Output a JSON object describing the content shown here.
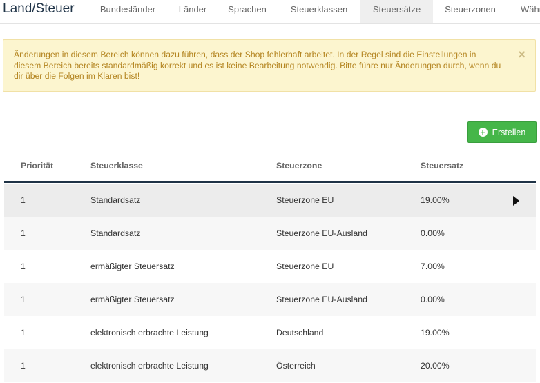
{
  "app_title": "Land/Steuer",
  "nav": {
    "tabs": [
      {
        "label": "Bundesländer",
        "active": false
      },
      {
        "label": "Länder",
        "active": false
      },
      {
        "label": "Sprachen",
        "active": false
      },
      {
        "label": "Steuerklassen",
        "active": false
      },
      {
        "label": "Steuersätze",
        "active": true
      },
      {
        "label": "Steuerzonen",
        "active": false
      },
      {
        "label": "Währ",
        "active": false
      }
    ]
  },
  "alert": {
    "text": "Änderungen in diesem Bereich können dazu führen, dass der Shop fehlerhaft arbeitet. In der Regel sind die Einstellungen in diesem Bereich bereits standardmäßig korrekt und es ist keine Bearbeitung notwendig. Bitte führe nur Änderungen durch, wenn du dir über die Folgen im Klaren bist!",
    "close_label": "×"
  },
  "toolbar": {
    "create_label": "Erstellen",
    "create_icon": "plus-circle-icon"
  },
  "table": {
    "headers": [
      "Priorität",
      "Steuerklasse",
      "Steuerzone",
      "Steuersatz"
    ],
    "rows": [
      [
        "1",
        "Standardsatz",
        "Steuerzone EU",
        "19.00%"
      ],
      [
        "1",
        "Standardsatz",
        "Steuerzone EU-Ausland",
        "0.00%"
      ],
      [
        "1",
        "ermäßigter Steuersatz",
        "Steuerzone EU",
        "7.00%"
      ],
      [
        "1",
        "ermäßigter Steuersatz",
        "Steuerzone EU-Ausland",
        "0.00%"
      ],
      [
        "1",
        "elektronisch erbrachte Leistung",
        "Deutschland",
        "19.00%"
      ],
      [
        "1",
        "elektronisch erbrachte Leistung",
        "Österreich",
        "20.00%"
      ]
    ],
    "selected_row": 0
  },
  "colors": {
    "accent_dark": "#1f3347",
    "alert_bg": "#fcf5cf",
    "alert_text": "#b48521",
    "create_button": "#45b649"
  }
}
